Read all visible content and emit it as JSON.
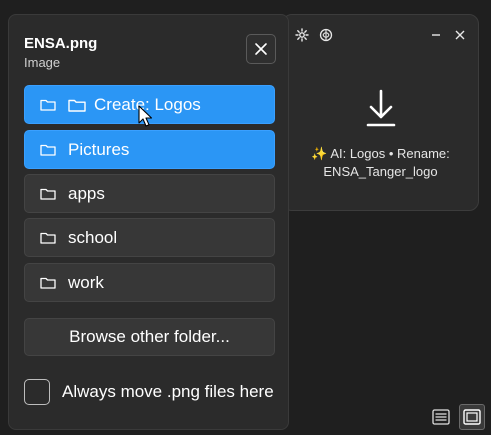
{
  "popup": {
    "file_name": "ENSA.png",
    "file_type": "Image",
    "close_icon": "close-icon",
    "folders": [
      {
        "label": "Create: Logos",
        "highlighted": true,
        "icon": "folder-icon"
      },
      {
        "label": "Pictures",
        "highlighted": true,
        "icon": "folder-icon"
      },
      {
        "label": "apps",
        "highlighted": false,
        "icon": "folder-icon"
      },
      {
        "label": "school",
        "highlighted": false,
        "icon": "folder-icon"
      },
      {
        "label": "work",
        "highlighted": false,
        "icon": "folder-icon"
      }
    ],
    "browse_label": "Browse other folder...",
    "always_move_label": "Always move .png files here",
    "always_move_checked": false
  },
  "drop_window": {
    "settings_icon": "gear-icon",
    "ai_icon": "ai-icon",
    "minimize_icon": "minimize-icon",
    "close_icon": "close-icon",
    "drop_icon": "download-icon",
    "suggestion_line1": "✨ AI: Logos • Rename:",
    "suggestion_line2": "ENSA_Tanger_logo"
  },
  "view_toggle": {
    "list_icon": "list-view-icon",
    "compact_icon": "compact-view-icon",
    "active": "compact"
  },
  "colors": {
    "accent": "#2b96f5",
    "surface": "#2b2b2b",
    "button": "#373737"
  }
}
